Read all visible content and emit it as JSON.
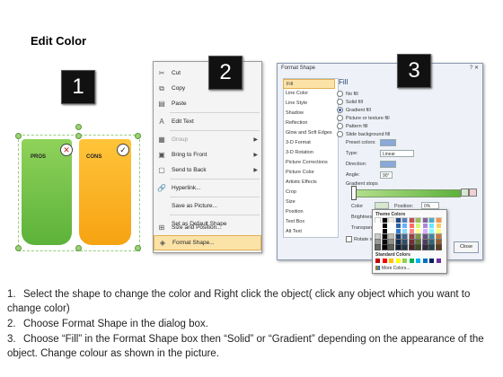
{
  "title": "Edit Color",
  "badges": [
    "1",
    "2",
    "3"
  ],
  "panel1": {
    "pros_label": "PROS",
    "cons_label": "CONS",
    "colors": {
      "green": "#6cc044",
      "orange": "#f9b21c"
    }
  },
  "menu": {
    "items": [
      {
        "label": "Cut",
        "icon": "scissors-icon"
      },
      {
        "label": "Copy",
        "icon": "copy-icon"
      },
      {
        "label": "Paste",
        "icon": "paste-icon"
      },
      {
        "label": "Edit Text",
        "icon": "edit-text-icon"
      },
      {
        "label": "Group",
        "icon": "group-icon",
        "submenu": true,
        "disabled": true
      },
      {
        "label": "Bring to Front",
        "icon": "bring-front-icon",
        "submenu": true
      },
      {
        "label": "Send to Back",
        "icon": "send-back-icon",
        "submenu": true
      },
      {
        "label": "Hyperlink...",
        "icon": "hyperlink-icon"
      },
      {
        "label": "Save as Picture...",
        "icon": ""
      },
      {
        "label": "Set as Default Shape",
        "icon": ""
      },
      {
        "label": "Size and Position...",
        "icon": "size-icon"
      },
      {
        "label": "Format Shape...",
        "icon": "format-shape-icon",
        "highlighted": true
      }
    ]
  },
  "dialog": {
    "title": "Format Shape",
    "window_buttons": "? ✕",
    "categories": [
      "Fill",
      "Line Color",
      "Line Style",
      "Shadow",
      "Reflection",
      "Glow and Soft Edges",
      "3-D Format",
      "3-D Rotation",
      "Picture Corrections",
      "Picture Color",
      "Artistic Effects",
      "Crop",
      "Size",
      "Position",
      "Text Box",
      "Alt Text"
    ],
    "fill_heading": "Fill",
    "fill_options": [
      "No fill",
      "Solid fill",
      "Gradient fill",
      "Picture or texture fill",
      "Pattern fill",
      "Slide background fill"
    ],
    "selected_fill": "Gradient fill",
    "preset_colors_label": "Preset colors:",
    "type_label": "Type:",
    "type_value": "Linear",
    "direction_label": "Direction:",
    "angle_label": "Angle:",
    "angle_value": "90°",
    "gradient_stops_label": "Gradient stops",
    "color_label": "Color",
    "position_label": "Position:",
    "position_value": "0%",
    "brightness_label": "Brightness",
    "transparency_label": "Transparency",
    "rotate_label": "Rotate w",
    "close_label": "Close",
    "theme_colors_label": "Theme Colors",
    "standard_colors_label": "Standard Colors",
    "more_colors_label": "More Colors..."
  },
  "instructions": [
    {
      "num": "1.",
      "text": "Select the shape to change the color and Right click the object( click any object which you want to change color)"
    },
    {
      "num": "2.",
      "text": "Choose Format Shape in the dialog box."
    },
    {
      "num": "3.",
      "text": "Choose “Fill” in the Format Shape box then “Solid” or “Gradient” depending on the appearance of the object. Change colour as shown in the picture."
    }
  ]
}
